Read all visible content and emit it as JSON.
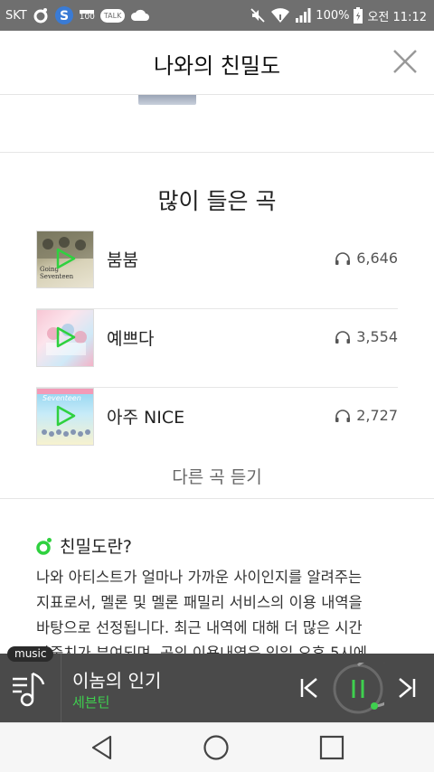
{
  "status_bar": {
    "carrier": "SKT",
    "badge_100": "100",
    "talk_label": "TALK",
    "battery": "100%",
    "time": "오전 11:12"
  },
  "header": {
    "title": "나와의 친밀도"
  },
  "most_played": {
    "title": "많이 들은 곡",
    "songs": [
      {
        "name": "붐붐",
        "count": "6,646",
        "cover_text": [
          "Going",
          "Seventeen"
        ]
      },
      {
        "name": "예쁘다",
        "count": "3,554"
      },
      {
        "name": "아주 NICE",
        "count": "2,727",
        "cover_text": [
          "Seventeen"
        ]
      }
    ],
    "more_label": "다른 곡 듣기"
  },
  "intimacy_info": {
    "title": "친밀도란?",
    "lines": [
      "나와 아티스트가 얼마나 가까운 사이인지를 알려주는",
      "지표로서, 멜론 및 멜론 패밀리 서비스의 이용 내역을",
      "바탕으로 선정됩니다. 최근 내역에 대해 더 많은 시간",
      "가중치가 부여되며, 곡의 이용내역은 익일 오후 5시에"
    ]
  },
  "player": {
    "tag": "music",
    "track_title": "이놈의 인기",
    "artist": "세븐틴",
    "accent": "#3fd04f"
  }
}
